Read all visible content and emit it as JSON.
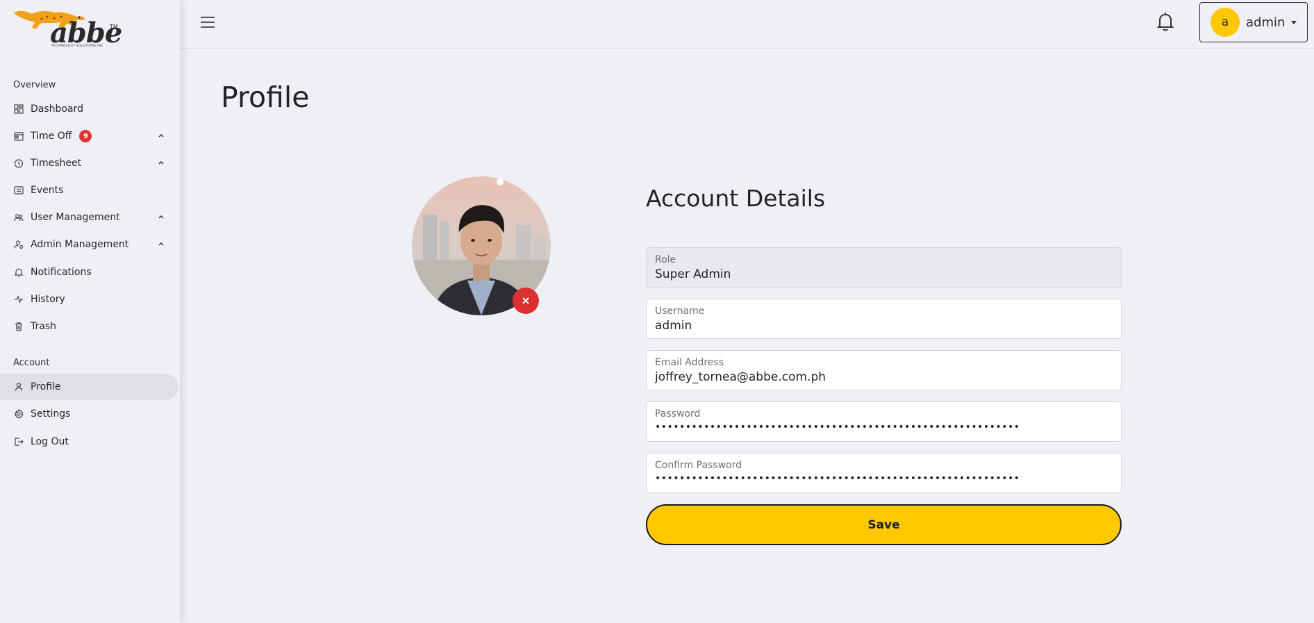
{
  "brand": {
    "logo_text": "abbe",
    "logo_tm": "TM",
    "logo_sub": "TECHNOLOGY SOLUTIONS INC.",
    "accent": "#ffc800"
  },
  "sidebar": {
    "overview_label": "Overview",
    "account_label": "Account",
    "items": [
      {
        "label": "Dashboard",
        "icon": "dashboard-icon"
      },
      {
        "label": "Time Off",
        "icon": "time-off-icon",
        "badge": "9",
        "expandable": true
      },
      {
        "label": "Timesheet",
        "icon": "clock-icon",
        "expandable": true
      },
      {
        "label": "Events",
        "icon": "events-icon"
      },
      {
        "label": "User Management",
        "icon": "users-icon",
        "expandable": true
      },
      {
        "label": "Admin Management",
        "icon": "admin-icon",
        "expandable": true
      },
      {
        "label": "Notifications",
        "icon": "bell-icon"
      },
      {
        "label": "History",
        "icon": "history-icon"
      },
      {
        "label": "Trash",
        "icon": "trash-icon"
      }
    ],
    "account_items": [
      {
        "label": "Profile",
        "icon": "user-icon",
        "active": true
      },
      {
        "label": "Settings",
        "icon": "gear-icon"
      },
      {
        "label": "Log Out",
        "icon": "logout-icon"
      }
    ]
  },
  "topbar": {
    "user_initial": "a",
    "user_name": "admin"
  },
  "page": {
    "title": "Profile"
  },
  "account": {
    "title": "Account Details",
    "role_label": "Role",
    "role_value": "Super Admin",
    "username_label": "Username",
    "username_value": "admin",
    "email_label": "Email Address",
    "email_value": "joffrey_tornea@abbe.com.ph",
    "password_label": "Password",
    "password_value": "••••••••••••••••••••••••••••••••••••••••••••••••••••••••••••",
    "confirm_label": "Confirm Password",
    "confirm_value": "••••••••••••••••••••••••••••••••••••••••••••••••••••••••••••",
    "save_label": "Save"
  },
  "colors": {
    "badge": "#e03131",
    "remove_button": "#dc2f2f",
    "background": "#eff0f5"
  }
}
